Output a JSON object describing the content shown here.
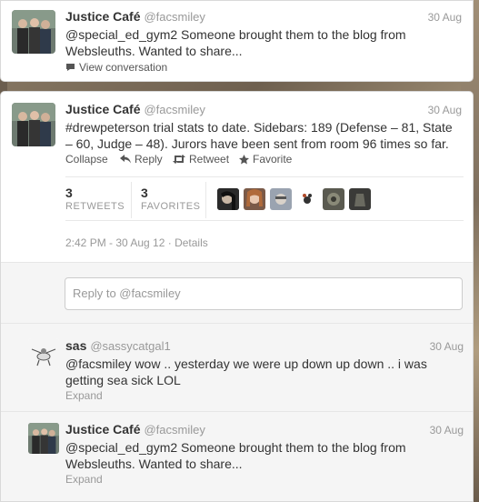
{
  "tweet1": {
    "name": "Justice Café",
    "handle": "@facsmiley",
    "date": "30 Aug",
    "text_line1": "@special_ed_gym2 Someone brought them to the blog from",
    "text_line2": "Websleuths. Wanted to share...",
    "view_conversation": "View conversation"
  },
  "tweet2": {
    "name": "Justice Café",
    "handle": "@facsmiley",
    "date": "30 Aug",
    "text_line1": "#drewpeterson trial stats to date. Sidebars: 189 (Defense – 81, State",
    "text_line2": "– 60, Judge – 48). Jurors have been sent from room 96 times so far.",
    "actions": {
      "collapse": "Collapse",
      "reply": "Reply",
      "retweet": "Retweet",
      "favorite": "Favorite"
    },
    "retweets_count": "3",
    "retweets_label": "RETWEETS",
    "favorites_count": "3",
    "favorites_label": "FAVORITES",
    "timestamp": "2:42 PM - 30 Aug 12",
    "details": "Details"
  },
  "reply_box": {
    "placeholder": "Reply to @facsmiley"
  },
  "reply1": {
    "name": "sas",
    "handle": "@sassycatgal1",
    "date": "30 Aug",
    "text_line1": "@facsmiley wow .. yesterday we were up down up down .. i was",
    "text_line2": "getting sea sick LOL",
    "expand": "Expand"
  },
  "reply2": {
    "name": "Justice Café",
    "handle": "@facsmiley",
    "date": "30 Aug",
    "text_line1": "@special_ed_gym2 Someone brought them to the blog from",
    "text_line2": "Websleuths. Wanted to share...",
    "expand": "Expand"
  }
}
